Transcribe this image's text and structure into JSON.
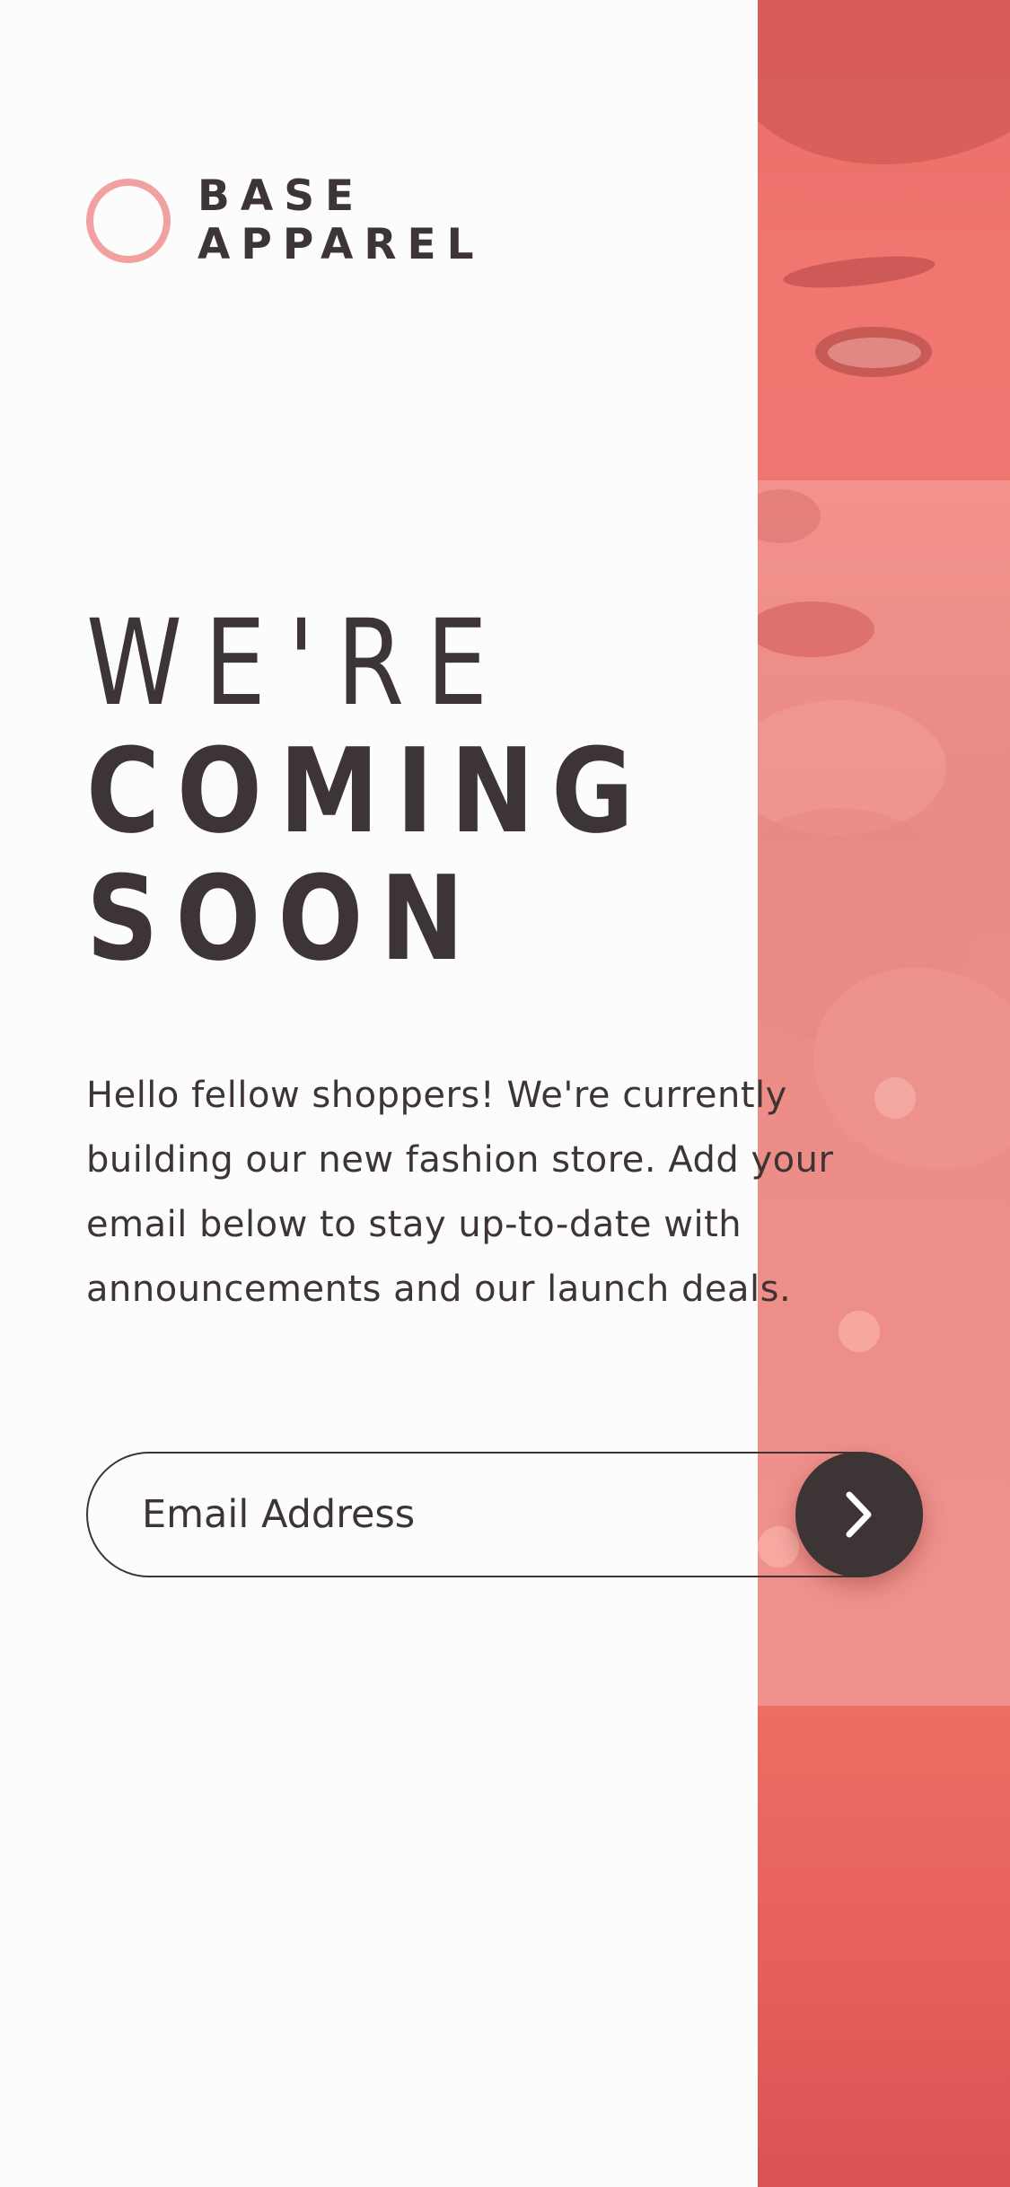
{
  "brand": {
    "name_line1": "BASE",
    "name_line2": "APPAREL",
    "logo_icon": "ring-logo-icon",
    "logo_color": "#f1a1a0"
  },
  "headline": {
    "light": "WE'RE",
    "bold_line1": "COMING",
    "bold_line2": "SOON"
  },
  "description": "Hello fellow shoppers! We're currently building our new fashion store. Add your email below to stay up-to-date with announcements and our launch deals.",
  "form": {
    "email_placeholder": "Email Address",
    "email_value": "",
    "submit_icon": "chevron-right-icon"
  },
  "colors": {
    "text": "#3d3435",
    "accent": "#f07c76",
    "background": "#fdfcfc"
  }
}
